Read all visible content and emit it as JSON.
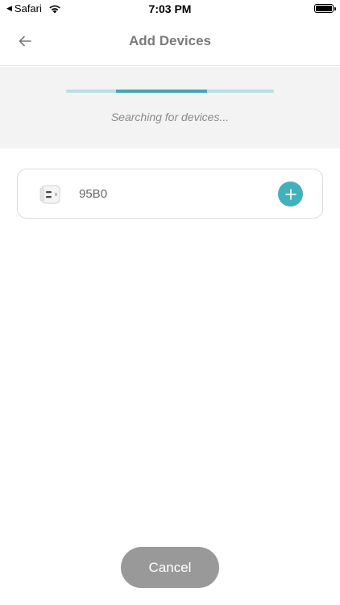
{
  "status_bar": {
    "back_app": "Safari",
    "time": "7:03 PM"
  },
  "nav": {
    "title": "Add Devices",
    "back_icon": "arrow-left-icon"
  },
  "search": {
    "status_text": "Searching for devices...",
    "progress": {
      "start": 0.24,
      "end": 0.68
    }
  },
  "devices": [
    {
      "name": "95B0",
      "icon": "smart-plug-icon",
      "action_icon": "plus-icon"
    }
  ],
  "footer": {
    "cancel_label": "Cancel"
  },
  "colors": {
    "accent": "#43b0bd",
    "progress_track": "#b8dfe3",
    "cancel_bg": "#999999"
  }
}
